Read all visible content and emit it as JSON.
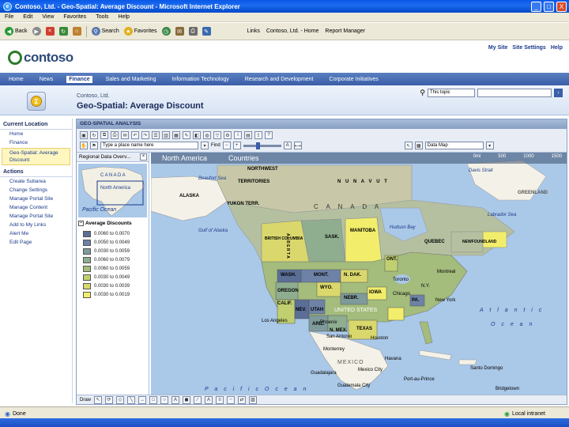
{
  "window": {
    "title": "Contoso, Ltd. - Geo-Spatial: Average Discount - Microsoft Internet Explorer",
    "controls": [
      "_",
      "□",
      "X"
    ]
  },
  "menu": [
    "File",
    "Edit",
    "View",
    "Favorites",
    "Tools",
    "Help"
  ],
  "toolbar": {
    "back": "Back",
    "search": "Search",
    "favorites": "Favorites",
    "links_label": "Links",
    "links": [
      "Contoso, Ltd. - Home",
      "Report Manager"
    ]
  },
  "site": {
    "logo": "contoso",
    "links": [
      "My Site",
      "Site Settings",
      "Help"
    ]
  },
  "topnav": [
    "Home",
    "News",
    "Finance",
    "Sales and Marketing",
    "Information Technology",
    "Research and Development",
    "Corporate Initiatives"
  ],
  "topnav_active": "Finance",
  "header": {
    "site_name": "Contoso, Ltd.",
    "page_title": "Geo-Spatial: Average Discount",
    "search_scope": "This topic"
  },
  "leftnav": {
    "current_heading": "Current Location",
    "current_items": [
      "Home",
      "Finance",
      "Geo-Spatial: Average Discount"
    ],
    "actions_heading": "Actions",
    "action_items": [
      "Create Subarea",
      "Change Settings",
      "Manage Portal Site",
      "Manage Content",
      "Manage Portal Site",
      "Add to My Links",
      "Alert Me",
      "Edit Page"
    ]
  },
  "geo": {
    "panel_title": "GEO-SPATIAL ANALYSIS",
    "type_select": "Type a place name here",
    "find_label": "Find",
    "view_select": "Data Map",
    "overview_title": "Regional Data Overv...",
    "overview_region": "North America",
    "overview_sea": "Pacific Ocean",
    "legend_title": "Average Discounts",
    "legend": [
      {
        "label": "0.0060 to 0.0070",
        "color": "#5a6e96"
      },
      {
        "label": "0.0050 to 0.0049",
        "color": "#6d82a6"
      },
      {
        "label": "0.0030 to 0.0059",
        "color": "#7f9a9a"
      },
      {
        "label": "0.0060 to 0.0079",
        "color": "#8fae90"
      },
      {
        "label": "0.0060 to 0.0059",
        "color": "#a4bc7c"
      },
      {
        "label": "0.0030 to 0.0049",
        "color": "#c0d070"
      },
      {
        "label": "0.0030 to 0.0039",
        "color": "#dad86c"
      },
      {
        "label": "0.0030 to 0.0019",
        "color": "#f2ee6c"
      }
    ],
    "breadcrumb": [
      "North America",
      "Countries"
    ],
    "scale": [
      "0mi",
      "500",
      "1000",
      "1500"
    ],
    "bottom_draw": "Draw"
  },
  "map_labels": {
    "northwest": "NORTHWEST",
    "territories": "TERRITORIES",
    "nunavut": "N U N A V U T",
    "alaska": "ALASKA",
    "yukon": "YUKON TERR.",
    "canada": "C A N A D A",
    "alberta": "A L B E R T A",
    "manitoba": "MANITOBA",
    "british_columbia": "BRITISH COLUMBIA",
    "sask": "SASK.",
    "quebec": "QUEBEC",
    "newfoundland": "NEWFOUNDLAND",
    "ont": "ONT.",
    "wash": "WASH.",
    "mont": "MONT.",
    "n_dak": "N. DAK.",
    "oregon": "OREGON",
    "wyo": "WYO.",
    "nebr": "NEBR.",
    "iowa": "IOWA",
    "calif": "CALIF.",
    "nev": "NEV.",
    "utah": "UTAH",
    "united_states": "UNITED STATES",
    "pa": "PA.",
    "ariz": "ARIZ.",
    "n_mex": "N. MEX.",
    "texas": "TEXAS",
    "los_angeles": "Los Angeles",
    "phoenix": "Phoenix",
    "san_antonio": "San Antonio",
    "houston": "Houston",
    "toronto": "Toronto",
    "chicago": "Chicago",
    "montreal": "Montreal",
    "new_york": "New York",
    "ny": "N.Y.",
    "monterrey": "Monterrey",
    "mexico": "MEXICO",
    "guadalajara": "Guadalajara",
    "mexico_city": "Mexico City",
    "havana": "Havana",
    "santo_domingo": "Santo Domingo",
    "guatemala_city": "Guatemala City",
    "port_au_prince": "Port-au-Prince",
    "bridgetown": "Bridgetown",
    "pacific": "P a c i f i c     O c e a n",
    "atlantic": "A t l a n t i c",
    "ocean": "O c e a n",
    "davis_strait": "Davis Strait",
    "labrador_sea": "Labrador Sea",
    "greenland": "GREENLAND",
    "hudson_bay": "Hudson Bay",
    "beaufort": "Beaufort Sea",
    "gulf_alaska": "Gulf of Alaska"
  },
  "status": {
    "left": "Done",
    "right": "Local intranet"
  }
}
